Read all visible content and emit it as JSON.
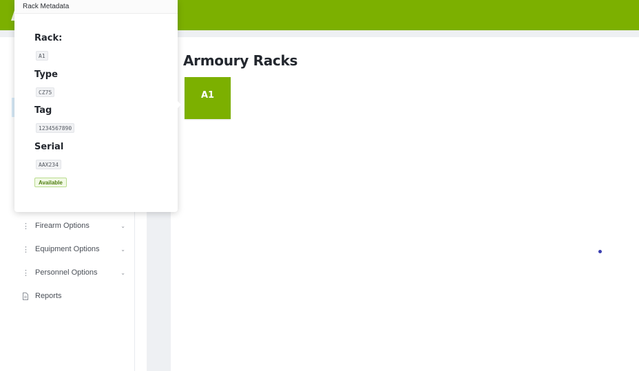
{
  "colors": {
    "accent": "#7cb000",
    "tile_text": "#ffffff",
    "badge_bg": "#f2fae6",
    "badge_text": "#4f7d10"
  },
  "sidebar": {
    "items": [
      {
        "label": "Firearm Options",
        "icon": "drag-handle-icon",
        "has_chevron": true
      },
      {
        "label": "Equipment Options",
        "icon": "drag-handle-icon",
        "has_chevron": true
      },
      {
        "label": "Personnel Options",
        "icon": "drag-handle-icon",
        "has_chevron": true
      },
      {
        "label": "Reports",
        "icon": "document-icon",
        "has_chevron": false
      }
    ]
  },
  "main": {
    "title": "Armoury Racks",
    "racks": [
      {
        "label": "A1"
      }
    ]
  },
  "popover": {
    "header": "Rack Metadata",
    "fields": [
      {
        "label": "Rack:",
        "value": "A1"
      },
      {
        "label": "Type",
        "value": "CZ75"
      },
      {
        "label": "Tag",
        "value": "1234567890"
      },
      {
        "label": "Serial",
        "value": "AAX234"
      }
    ],
    "status": "Available"
  }
}
